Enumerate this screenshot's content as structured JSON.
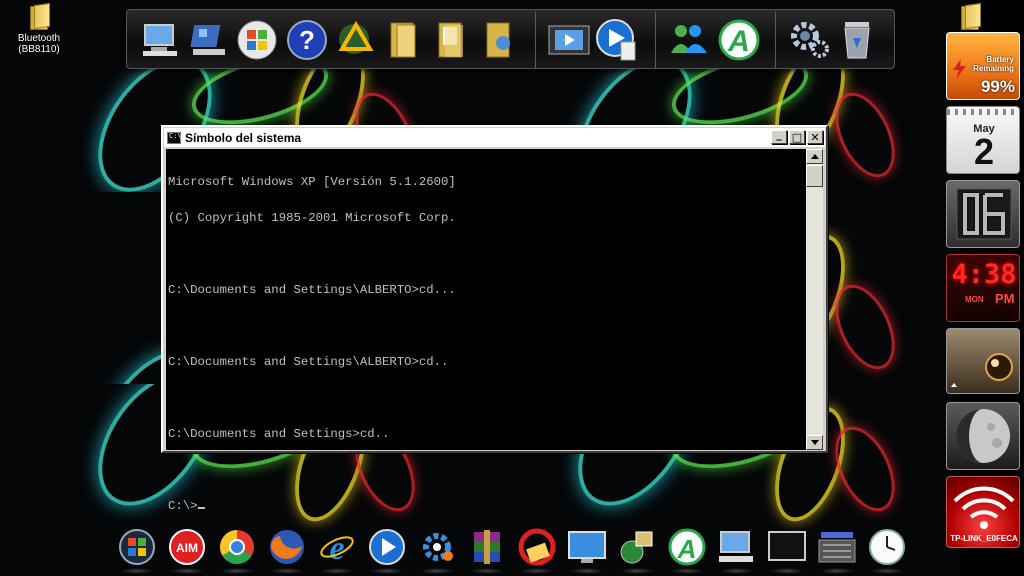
{
  "desktop": {
    "icons": [
      {
        "label": "Bluetooth\n(BB8110)"
      }
    ]
  },
  "console": {
    "title": "Símbolo del sistema",
    "buttons": {
      "minimize": "_",
      "maximize": "□",
      "close": "✕"
    },
    "lines": [
      "Microsoft Windows XP [Versión 5.1.2600]",
      "(C) Copyright 1985-2001 Microsoft Corp.",
      "",
      "C:\\Documents and Settings\\ALBERTO>cd...",
      "",
      "C:\\Documents and Settings\\ALBERTO>cd..",
      "",
      "C:\\Documents and Settings>cd..",
      "",
      "C:\\>"
    ]
  },
  "top_dock": {
    "icons": [
      "my-computer-icon",
      "control-panel-icon",
      "windows-start-icon",
      "help-icon",
      "media-center-icon",
      "folder-icon",
      "documents-folder-icon",
      "pictures-folder-icon",
      "movie-maker-icon",
      "media-player-icon",
      "messenger-icon",
      "app-a-icon",
      "settings-icon",
      "recycle-bin-icon"
    ]
  },
  "bottom_dock": {
    "icons": [
      "windows-start-icon",
      "aim-icon",
      "chrome-icon",
      "firefox-icon",
      "internet-explorer-icon",
      "media-player-icon",
      "settings-gear-icon",
      "winrar-icon",
      "cleaner-icon",
      "monitor-icon",
      "network-icon",
      "app-a-icon",
      "my-computer-icon",
      "black-window-icon",
      "keyboard-icon",
      "clock-icon"
    ]
  },
  "sidebar": {
    "battery": {
      "title": "Battery",
      "subtitle": "Remaining",
      "percent": "99%"
    },
    "calendar": {
      "month": "May",
      "day": "2"
    },
    "clock": {
      "time": "4:38",
      "day": "MON",
      "ampm": "PM"
    },
    "wifi": {
      "ssid": "TP-LINK_E0FECA"
    }
  },
  "colors": {
    "console_bg": "#000000",
    "console_text": "#c0c0c0",
    "window_chrome": "#d4d0c8",
    "battery_orange": "#f07a1a",
    "clock_red": "#e0201a"
  }
}
